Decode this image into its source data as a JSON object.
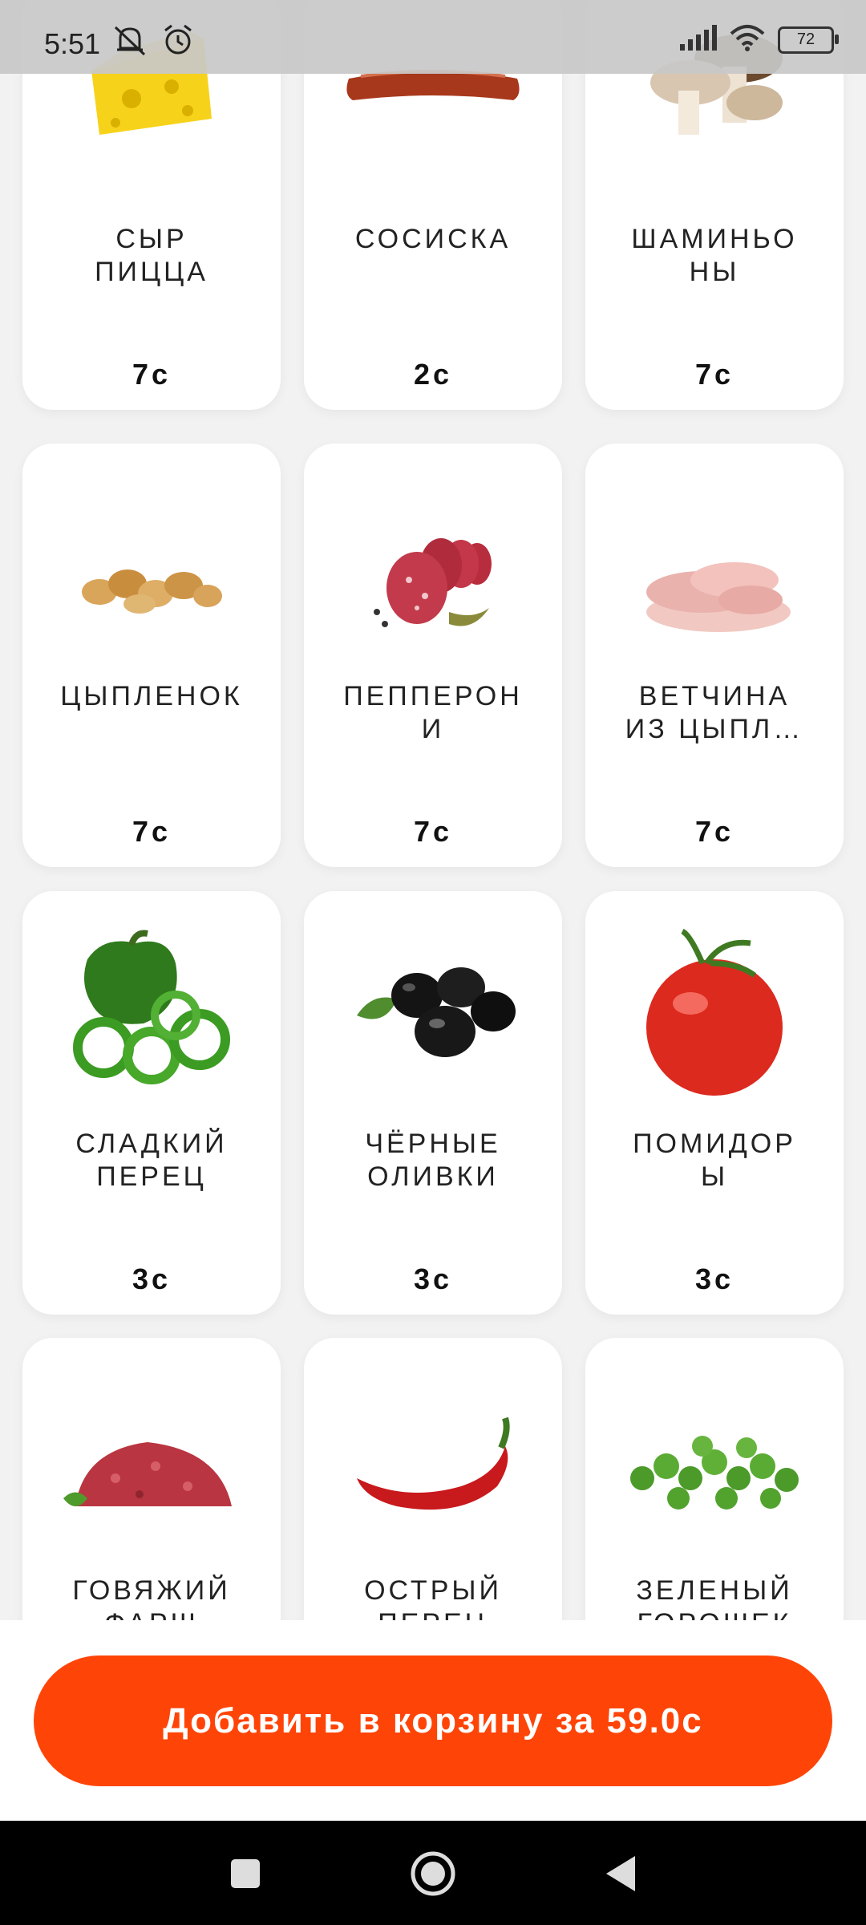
{
  "status_bar": {
    "time": "5:51",
    "battery": "72",
    "icons": [
      "notifications-off-icon",
      "alarm-icon",
      "signal-icon",
      "wifi-icon",
      "battery-icon"
    ]
  },
  "products": [
    {
      "name": "СЫР\nПИЦЦА",
      "price": "7с",
      "icon": "cheese-image"
    },
    {
      "name": "СОСИСКА",
      "price": "2с",
      "icon": "sausage-image"
    },
    {
      "name": "ШАМИНЬО\nНЫ",
      "price": "7с",
      "icon": "mushrooms-image"
    },
    {
      "name": "ЦЫПЛЕНОК",
      "price": "7с",
      "icon": "chicken-image"
    },
    {
      "name": "ПЕППЕРОН\nИ",
      "price": "7с",
      "icon": "pepperoni-image"
    },
    {
      "name": "ВЕТЧИНА\nИЗ ЦЫПЛ…",
      "price": "7с",
      "icon": "ham-image"
    },
    {
      "name": "СЛАДКИЙ\nПЕРЕЦ",
      "price": "3с",
      "icon": "bell-pepper-image"
    },
    {
      "name": "ЧЁРНЫЕ\nОЛИВКИ",
      "price": "3с",
      "icon": "olives-image"
    },
    {
      "name": "ПОМИДОР\nЫ",
      "price": "3с",
      "icon": "tomato-image"
    },
    {
      "name": "ГОВЯЖИЙ\nФАРШ",
      "price": "",
      "icon": "minced-beef-image"
    },
    {
      "name": "ОСТРЫЙ\nПЕРЕЦ",
      "price": "",
      "icon": "chili-pepper-image"
    },
    {
      "name": "ЗЕЛЕНЫЙ\nГОРОШЕК",
      "price": "",
      "icon": "green-peas-image"
    }
  ],
  "cart_button": {
    "label": "Добавить в корзину за 59.0с",
    "color": "#ff4407"
  },
  "nav_bar": {
    "icons": [
      "recent-apps-icon",
      "home-icon",
      "back-icon"
    ]
  }
}
